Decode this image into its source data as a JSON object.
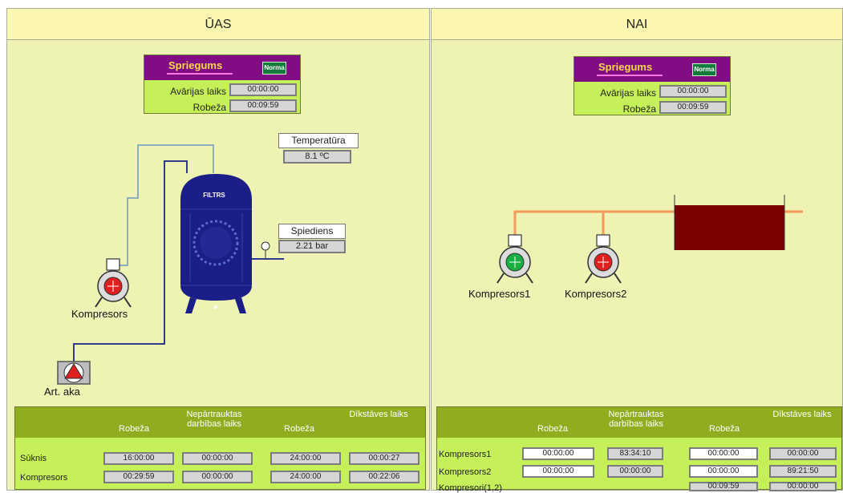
{
  "left": {
    "title": "ŪAS",
    "voltage": {
      "title": "Spriegums",
      "status": "Norma",
      "rows": [
        {
          "label": "Avārijas laiks",
          "value": "00:00:00"
        },
        {
          "label": "Robeža",
          "value": "00:09:59"
        }
      ]
    },
    "temperature": {
      "label": "Temperatūra",
      "value": "8.1 ºC"
    },
    "pressure": {
      "label": "Spiediens",
      "value": "2.21 bar"
    },
    "filter_label": "FILTRS",
    "compressor_label": "Kompresors",
    "well_label": "Art. aka",
    "table": {
      "headers": [
        "Robeža",
        "Nepārtrauktas darbības laiks",
        "Robeža",
        "Dīkstāves laiks"
      ],
      "rows": [
        {
          "label": "Sūknis",
          "values": [
            "16:00:00",
            "00:00:00",
            "24:00:00",
            "00:00:27"
          ]
        },
        {
          "label": "Kompresors",
          "values": [
            "00:29:59",
            "00:00:00",
            "24:00:00",
            "00:22:06"
          ]
        }
      ]
    }
  },
  "right": {
    "title": "NAI",
    "voltage": {
      "title": "Spriegums",
      "status": "Norma",
      "rows": [
        {
          "label": "Avārijas laiks",
          "value": "00:00:00"
        },
        {
          "label": "Robeža",
          "value": "00:09:59"
        }
      ]
    },
    "compressor1_label": "Kompresors1",
    "compressor2_label": "Kompresors2",
    "table": {
      "headers": [
        "Robeža",
        "Nepārtrauktas darbības laiks",
        "Robeža",
        "Dīkstāves laiks"
      ],
      "rows": [
        {
          "label": "Kompresors1",
          "values": [
            "00:00:00",
            "83:34:10",
            "00:00:00",
            "00:00:00"
          ]
        },
        {
          "label": "Kompresors2",
          "values": [
            "00:00:00",
            "00:00:00",
            "00:00:00",
            "89:21:50"
          ]
        },
        {
          "label": "Kompresori(1,2)",
          "values": [
            "",
            "",
            "00:09:59",
            "00:00:00"
          ]
        }
      ]
    }
  },
  "colors": {
    "panel_bg": "#eef3b4",
    "header_bg": "#fbf7b0",
    "value_box": "#c6f05a",
    "voltage_header": "#820c84",
    "filter_tank": "#1b1e86",
    "water_tank": "#7a0000",
    "pipe_light": "#8ab0c0",
    "pipe_dark": "#2f3a8a",
    "pipe_orange": "#f39a5c"
  }
}
